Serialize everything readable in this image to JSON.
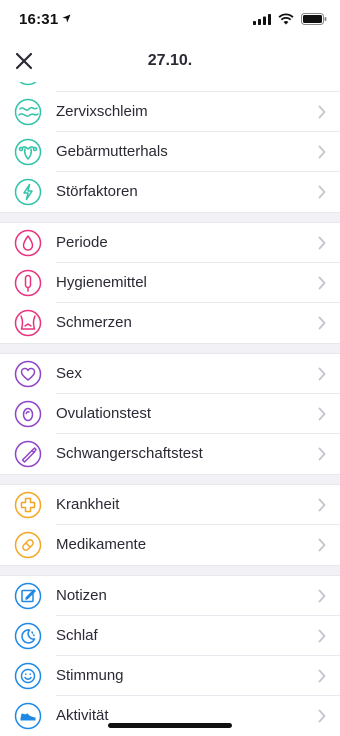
{
  "status": {
    "time": "16:31"
  },
  "nav": {
    "title": "27.10."
  },
  "colors": {
    "teal": "#2ec4a7",
    "pink": "#e8327e",
    "purple": "#8e44c9",
    "orange": "#f5a623",
    "blue": "#1e88e5"
  },
  "groups": [
    {
      "color": "teal",
      "items": [
        {
          "label": "",
          "icon": "partial-item-icon"
        },
        {
          "label": "Zervixschleim",
          "icon": "cervical-mucus-icon"
        },
        {
          "label": "Gebärmutterhals",
          "icon": "cervix-icon"
        },
        {
          "label": "Störfaktoren",
          "icon": "lightning-icon"
        }
      ]
    },
    {
      "color": "pink",
      "items": [
        {
          "label": "Periode",
          "icon": "drop-icon"
        },
        {
          "label": "Hygienemittel",
          "icon": "tampon-icon"
        },
        {
          "label": "Schmerzen",
          "icon": "body-pain-icon"
        }
      ]
    },
    {
      "color": "purple",
      "items": [
        {
          "label": "Sex",
          "icon": "heart-icon"
        },
        {
          "label": "Ovulationstest",
          "icon": "egg-icon"
        },
        {
          "label": "Schwangerschaftstest",
          "icon": "test-stick-icon"
        }
      ]
    },
    {
      "color": "orange",
      "items": [
        {
          "label": "Krankheit",
          "icon": "cross-icon"
        },
        {
          "label": "Medikamente",
          "icon": "pill-icon"
        }
      ]
    },
    {
      "color": "blue",
      "items": [
        {
          "label": "Notizen",
          "icon": "note-icon"
        },
        {
          "label": "Schlaf",
          "icon": "moon-icon"
        },
        {
          "label": "Stimmung",
          "icon": "smiley-icon"
        },
        {
          "label": "Aktivität",
          "icon": "shoe-icon"
        }
      ]
    }
  ]
}
